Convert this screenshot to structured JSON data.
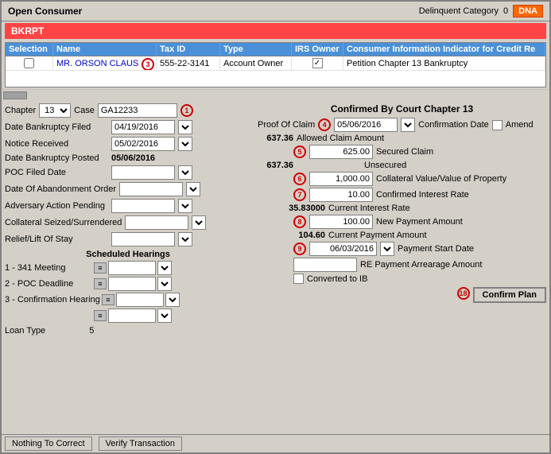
{
  "window": {
    "title": "Open Consumer",
    "delinquent_label": "Delinquent Category",
    "delinquent_value": "0",
    "dna_badge": "DNA",
    "bkrpt_label": "BKRPT"
  },
  "table": {
    "headers": [
      "Selection",
      "Name",
      "Tax ID",
      "Type",
      "IRS Owner",
      "Consumer Information Indicator for Credit Re"
    ],
    "rows": [
      {
        "selected": false,
        "name": "MR. ORSON CLAUS",
        "tax_id": "555-22-3141",
        "type": "Account Owner",
        "irs_owner": true,
        "credit_info": "Petition Chapter 13 Bankruptcy"
      }
    ]
  },
  "left_panel": {
    "chapter_label": "Chapter",
    "chapter_value": "13",
    "case_label": "Case",
    "case_value": "GA12233",
    "circle1": "1",
    "date_bankruptcy_filed_label": "Date Bankruptcy Filed",
    "date_bankruptcy_filed_value": "04/19/2016",
    "notice_received_label": "Notice Received",
    "notice_received_value": "05/02/2016",
    "date_bankruptcy_posted_label": "Date Bankruptcy Posted",
    "date_bankruptcy_posted_value": "05/06/2016",
    "poc_filed_date_label": "POC Filed Date",
    "poc_filed_date_value": "",
    "date_abandonment_label": "Date Of Abandonment Order",
    "date_abandonment_value": "",
    "adversary_action_label": "Adversary Action Pending",
    "adversary_action_value": "",
    "collateral_seized_label": "Collateral Seized/Surrendered",
    "collateral_seized_value": "",
    "relief_label": "Relief/Lift Of Stay",
    "relief_value": "",
    "scheduled_hearings_label": "Scheduled Hearings",
    "hearing1_label": "1 - 341 Meeting",
    "hearing1_value": "",
    "hearing2_label": "2 - POC Deadline",
    "hearing2_value": "",
    "hearing3_label": "3 - Confirmation Hearing",
    "hearing3_value": "",
    "hearing4_label": "",
    "hearing4_value": "",
    "loan_type_label": "Loan Type",
    "loan_type_value": "5"
  },
  "right_panel": {
    "title": "Confirmed By Court Chapter 13",
    "proof_of_claim_label": "Proof Of Claim",
    "circle4": "4",
    "proof_date_value": "05/06/2016",
    "confirmation_date_label": "Confirmation Date",
    "amend_label": "Amend",
    "amount1": "637.36",
    "circle5": "5",
    "secured_input_value": "625.00",
    "allowed_claim_label": "Allowed Claim Amount",
    "secured_label": "Secured Claim",
    "amount2": "637.36",
    "unsecured_label": "Unsecured",
    "circle6": "6",
    "collateral_input_value": "1,000.00",
    "collateral_label": "Collateral Value/Value of Property",
    "circle7": "7",
    "confirmed_interest_input": "10.00",
    "confirmed_interest_label": "Confirmed Interest Rate",
    "current_interest_value": "35.83000",
    "current_interest_label": "Current Interest Rate",
    "circle8": "8",
    "new_payment_input": "100.00",
    "new_payment_label": "New Payment Amount",
    "current_payment_value": "104.60",
    "current_payment_label": "Current Payment Amount",
    "circle9": "9",
    "payment_start_input": "06/03/2016",
    "payment_start_label": "Payment Start Date",
    "re_payment_label": "RE Payment Arrearage Amount",
    "re_payment_value": "",
    "converted_label": "Converted to IB",
    "circle18": "18",
    "confirm_plan_label": "Confirm Plan"
  },
  "bottom_bar": {
    "nothing_label": "Nothing To Correct",
    "verify_label": "Verify Transaction"
  }
}
